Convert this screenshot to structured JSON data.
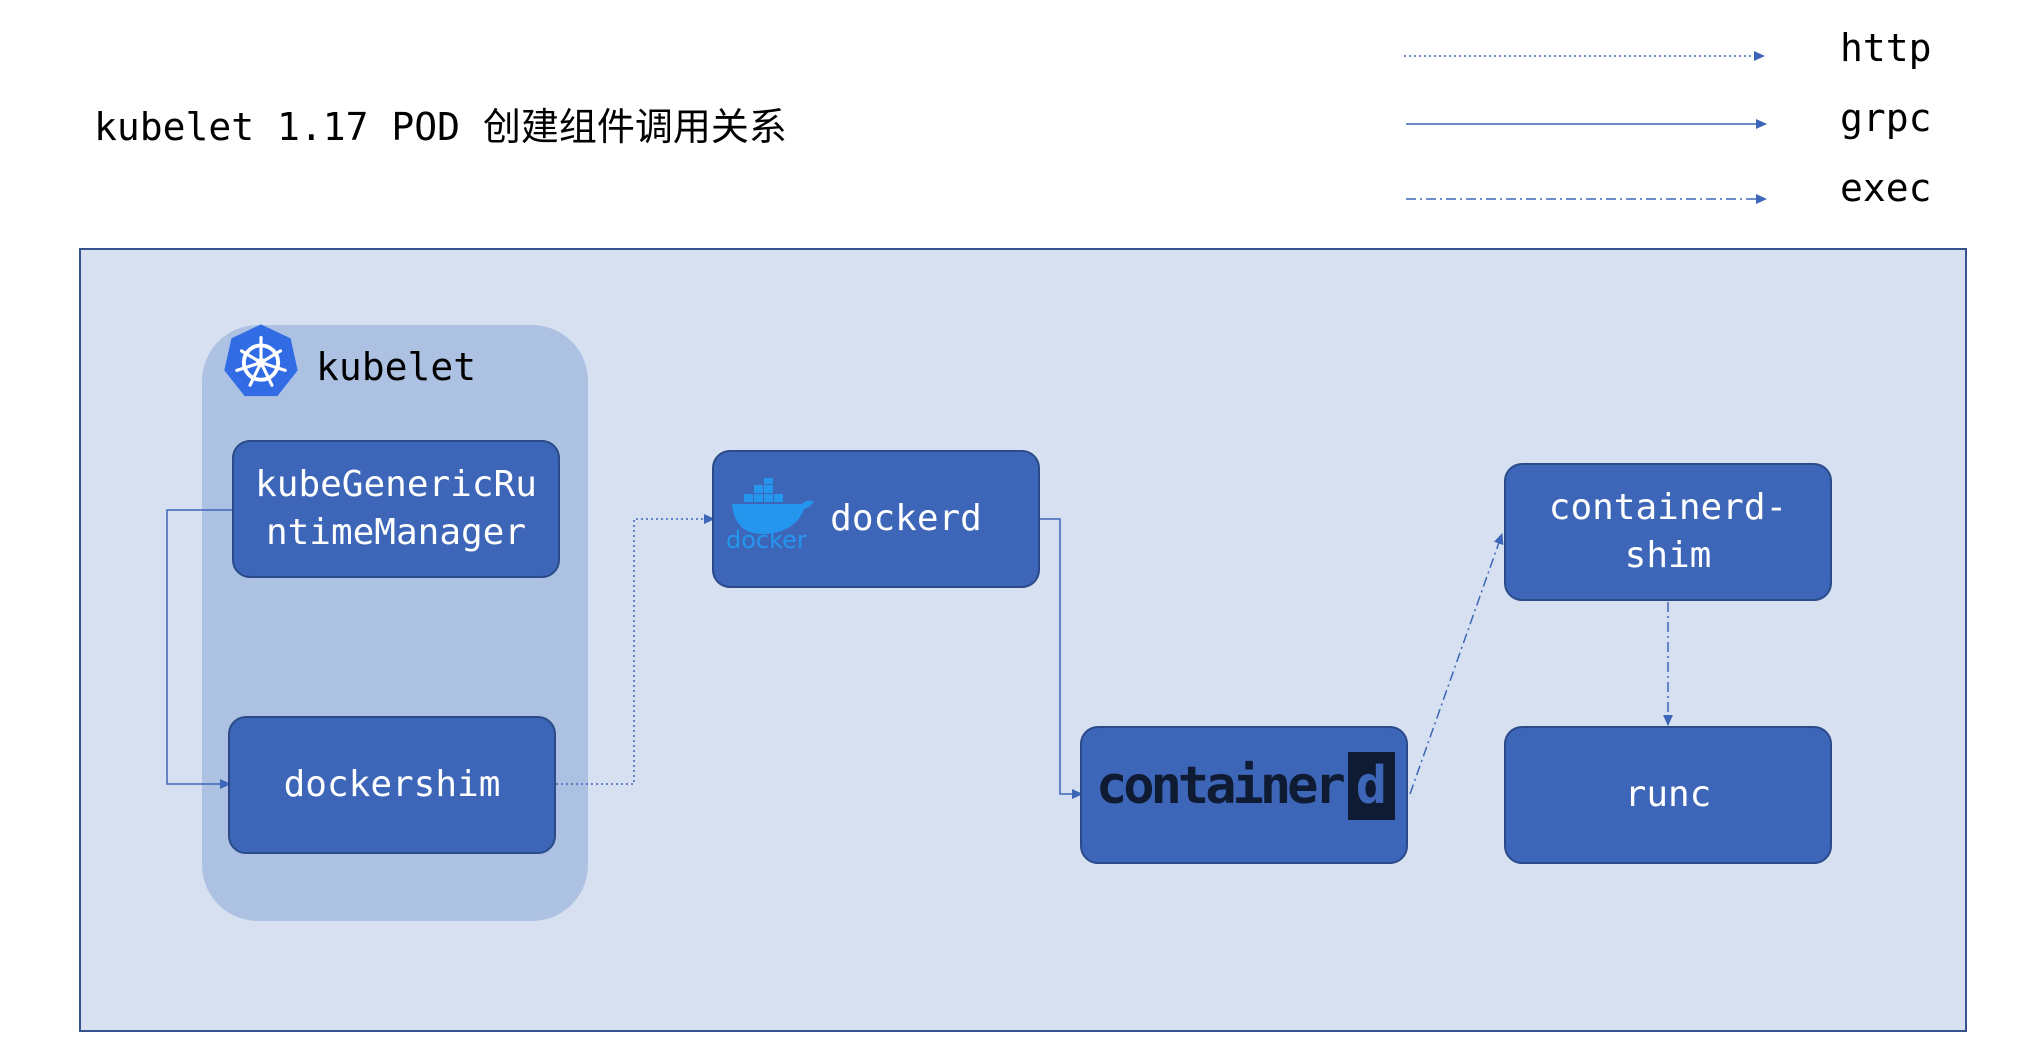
{
  "title": "kubelet 1.17 POD 创建组件调用关系",
  "legend": {
    "items": [
      {
        "label": "http",
        "style": "dotted"
      },
      {
        "label": "grpc",
        "style": "solid"
      },
      {
        "label": "exec",
        "style": "dash-dot"
      }
    ],
    "line_color": "#3d66b8"
  },
  "group": {
    "title": "kubelet",
    "icon": "kubernetes-helm-icon"
  },
  "nodes": {
    "kube_generic_line1": "kubeGenericRu",
    "kube_generic_line2": "ntimeManager",
    "dockershim": "dockershim",
    "dockerd": "dockerd",
    "docker_logo_text": "docker",
    "containerd_logo_text": "container",
    "containerd_logo_letter": "d",
    "containerd_shim_line1": "containerd-",
    "containerd_shim_line2": "shim",
    "runc": "runc"
  },
  "colors": {
    "frame_bg": "#d6e0f0",
    "group_bg": "#adc2e3",
    "box_bg": "#3d66b8",
    "box_text": "#ffffff",
    "k8s_blue": "#326ce5"
  }
}
